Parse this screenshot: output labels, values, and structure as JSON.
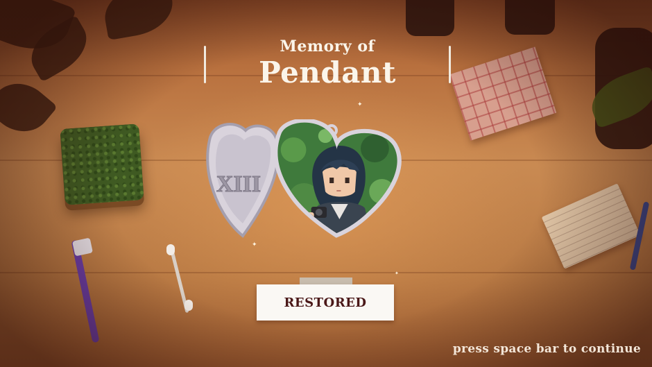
{
  "memory": {
    "prefix": "Memory of",
    "item_name": "Pendant",
    "locket_engraving": "XIII"
  },
  "status": {
    "label": "RESTORED"
  },
  "prompt": {
    "continue_text": "press space bar to continue"
  },
  "colors": {
    "title_text": "#fbf5ea",
    "badge_bg": "#faf8f4",
    "badge_text": "#4a1818",
    "locket_silver": "#d9d3dc",
    "portrait_foliage": "#3f7a3c"
  },
  "icons": [
    "heart-locket-icon",
    "portrait-icon",
    "sparkle-icon"
  ]
}
